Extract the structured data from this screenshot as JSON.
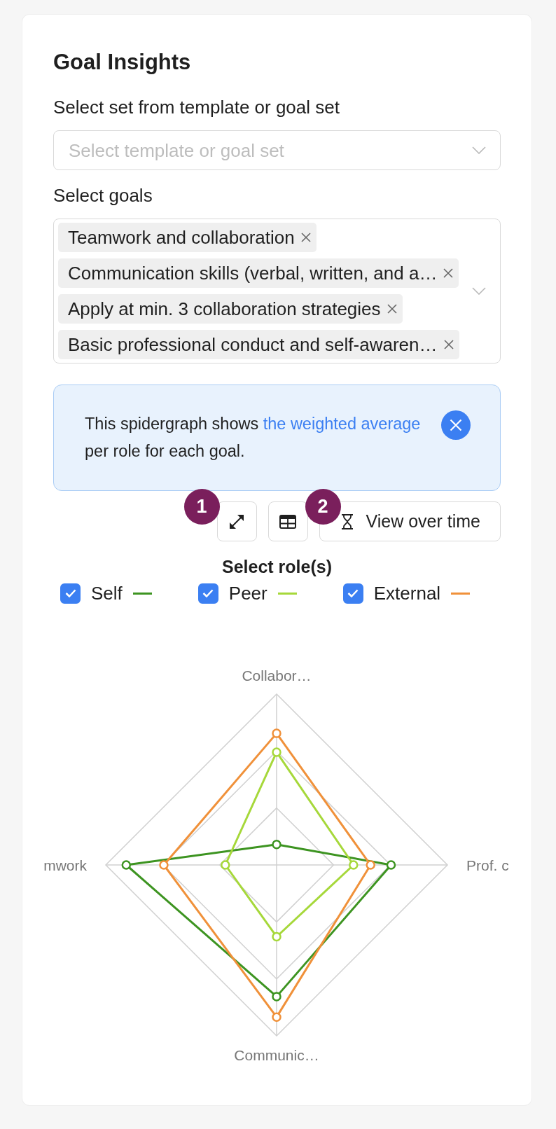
{
  "panel": {
    "title": "Goal Insights"
  },
  "template_select": {
    "label": "Select set from template or goal set",
    "placeholder": "Select template or goal set"
  },
  "goals_select": {
    "label": "Select goals",
    "tags": [
      {
        "label": "Teamwork and collaboration"
      },
      {
        "label": "Communication skills (verbal, written, and a…"
      },
      {
        "label": "Apply at min. 3 collaboration strategies"
      },
      {
        "label": "Basic professional conduct and self-awaren…"
      }
    ]
  },
  "info_banner": {
    "parts": [
      {
        "kind": "text",
        "text": "This spidergraph shows "
      },
      {
        "kind": "link",
        "text": "the weighted average"
      },
      {
        "kind": "text",
        "text": " per role for each goal."
      }
    ]
  },
  "toolbar": {
    "buttons": [
      {
        "kind": "expand",
        "marker": "1"
      },
      {
        "kind": "table"
      },
      {
        "kind": "history",
        "label": "View over time",
        "marker": "2"
      }
    ]
  },
  "roles": {
    "title": "Select role(s)",
    "items": [
      {
        "label": "Self",
        "checked": true,
        "color": "#3d9421"
      },
      {
        "label": "Peer",
        "checked": true,
        "color": "#a6d83a"
      },
      {
        "label": "External",
        "checked": true,
        "color": "#f0913a"
      }
    ]
  },
  "chart": {
    "axis_labels": [
      "Collabor…",
      "Prof. c",
      "Communic…",
      "mwork"
    ]
  }
}
